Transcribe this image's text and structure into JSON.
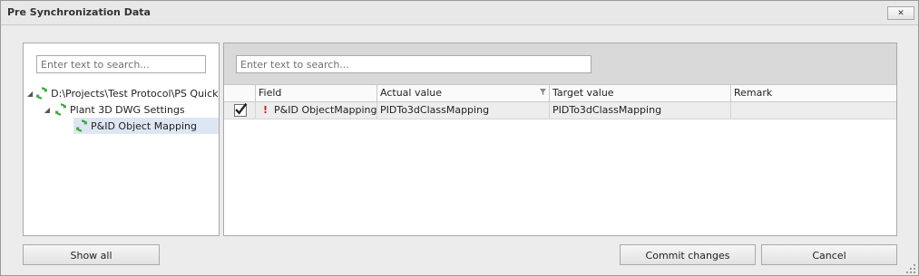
{
  "window": {
    "title": "Pre Synchronization Data",
    "close_symbol": "✕"
  },
  "tree": {
    "search_placeholder": "Enter text to search...",
    "nodes": [
      {
        "label": "D:\\Projects\\Test Protocol\\PS Quick - T",
        "expanded": true,
        "icon": "sync-icon"
      },
      {
        "label": "Plant 3D DWG Settings",
        "expanded": true,
        "icon": "sync-icon"
      },
      {
        "label": "P&ID Object Mapping",
        "selected": true,
        "icon": "sync-icon"
      }
    ]
  },
  "grid": {
    "search_placeholder": "Enter text to search...",
    "columns": [
      "",
      "Field",
      "Actual value",
      "Target value",
      "Remark"
    ],
    "rows": [
      {
        "checked": true,
        "warning": "!",
        "field": "P&ID ObjectMapping",
        "actual": "PIDTo3dClassMapping",
        "target": "PIDTo3dClassMapping",
        "remark": ""
      }
    ]
  },
  "buttons": {
    "show_all": "Show all",
    "commit": "Commit changes",
    "cancel": "Cancel"
  },
  "colors": {
    "sync_green": "#3aa536",
    "warning_red": "#d41414",
    "selected_row": "#dde6f3"
  }
}
